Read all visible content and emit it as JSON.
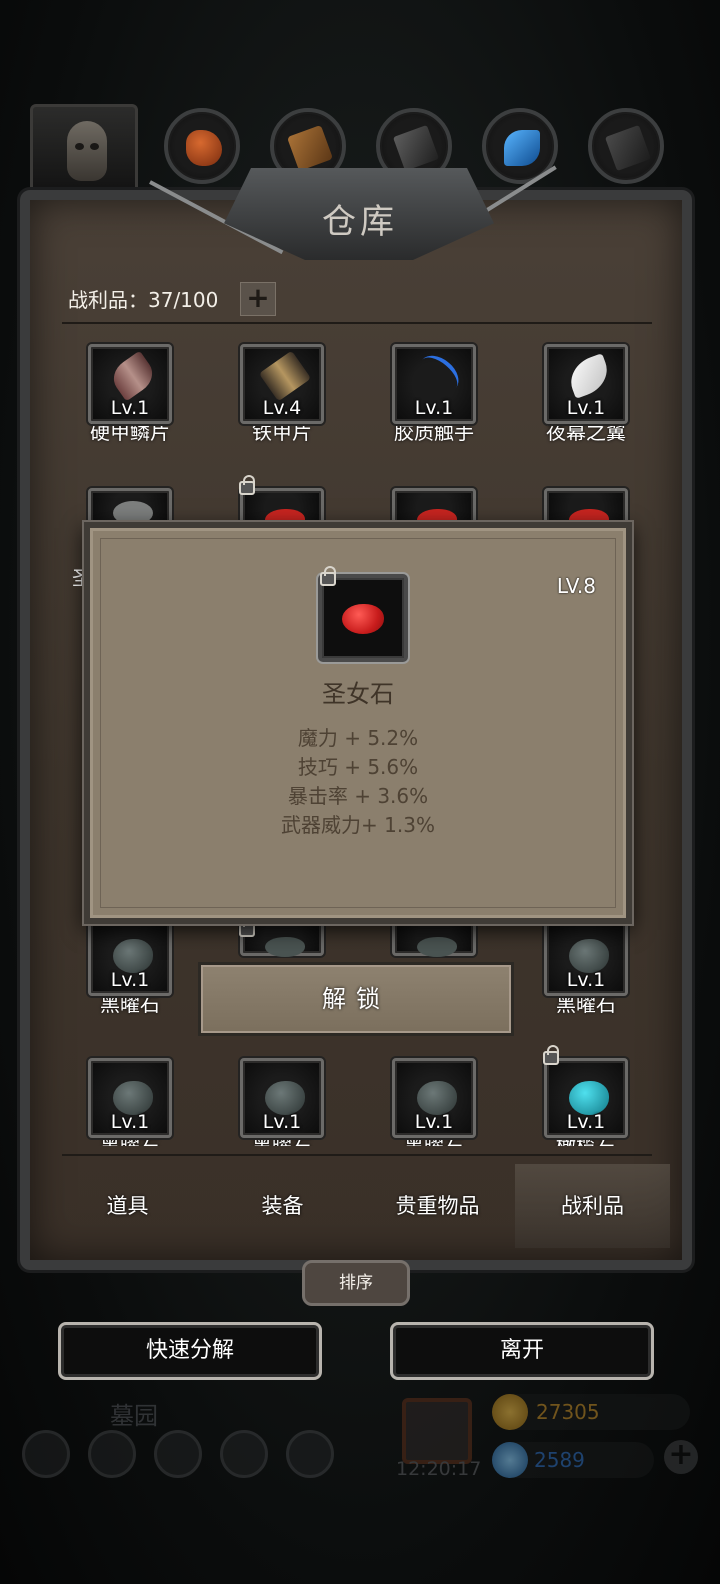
{
  "top_tabs": {
    "portrait": "skull-portrait",
    "tabs": [
      {
        "name": "tab-red-fish",
        "color": "#b7491f"
      },
      {
        "name": "tab-wood",
        "color": "#8a5a2d"
      },
      {
        "name": "tab-iron",
        "color": "#4e4e4e"
      },
      {
        "name": "tab-crystal",
        "color": "#1f6fbf"
      },
      {
        "name": "tab-dark",
        "color": "#3a3a3a"
      }
    ]
  },
  "panel": {
    "title": "仓库",
    "capacity_label": "战利品：37/100",
    "add_label": "+"
  },
  "items_row1": [
    {
      "level": "Lv.1",
      "name": "硬甲鳞片",
      "icon": "feather-scale-icon",
      "locked": false
    },
    {
      "level": "Lv.4",
      "name": "铁甲片",
      "icon": "iron-plate-icon",
      "locked": false
    },
    {
      "level": "Lv.1",
      "name": "胶质触手",
      "icon": "tentacle-icon",
      "locked": false
    },
    {
      "level": "Lv.1",
      "name": "夜幕之翼",
      "icon": "white-wing-icon",
      "locked": false
    }
  ],
  "items_row2_partial": {
    "visible_char": "圣"
  },
  "items_row3": [
    {
      "level": "Lv.1",
      "name": "黑曜石",
      "locked": false
    },
    {
      "level": "",
      "name": "",
      "locked": true
    },
    {
      "level": "",
      "name": "",
      "locked": false
    },
    {
      "level": "Lv.1",
      "name": "黑曜石",
      "locked": false
    }
  ],
  "items_row4": [
    {
      "level": "Lv.1",
      "name": "黑曜石",
      "locked": false,
      "color": "#3e4746"
    },
    {
      "level": "Lv.1",
      "name": "黑曜石",
      "locked": false,
      "color": "#3e4746"
    },
    {
      "level": "Lv.1",
      "name": "黑曜石",
      "locked": false,
      "color": "#3e4746"
    },
    {
      "level": "Lv.1",
      "name": "橄榄石",
      "locked": true,
      "color": "#1aa3b5"
    }
  ],
  "popup": {
    "level": "LV.8",
    "name": "圣女石",
    "stats": [
      "魔力 + 5.2%",
      "技巧 + 5.6%",
      "暴击率 + 3.6%",
      "武器威力+ 1.3%"
    ],
    "stone_color": "#d8221f"
  },
  "unlock_button": "解锁",
  "categories": [
    {
      "label": "道具",
      "active": false
    },
    {
      "label": "装备",
      "active": false
    },
    {
      "label": "贵重物品",
      "active": false
    },
    {
      "label": "战利品",
      "active": true
    }
  ],
  "sort_button": "排序",
  "quick_decompose_button": "快速分解",
  "leave_button": "离开",
  "hud": {
    "area_name": "墓园",
    "clock": "12:20:17",
    "gold": "27305",
    "gems": "2589",
    "add_label": "+"
  }
}
